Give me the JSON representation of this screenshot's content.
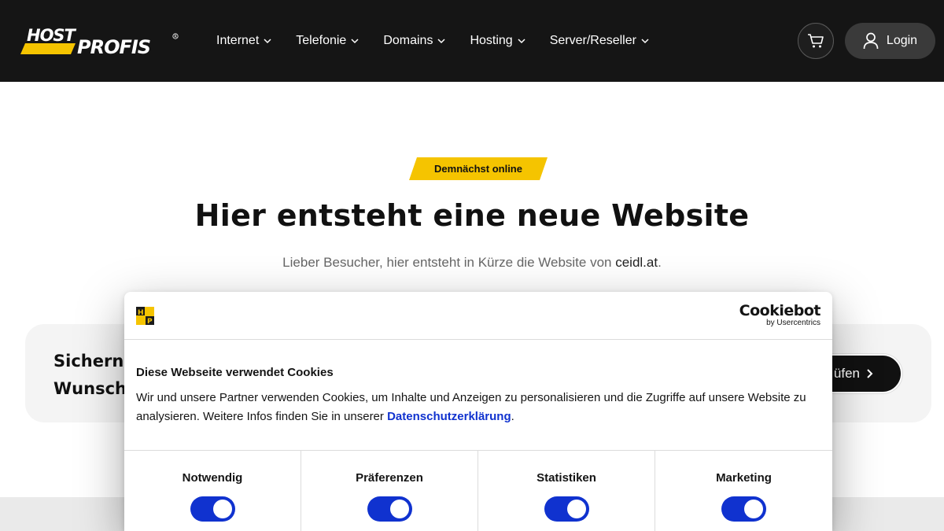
{
  "header": {
    "logo_text": "HOST PROFIS",
    "nav": [
      {
        "label": "Internet"
      },
      {
        "label": "Telefonie"
      },
      {
        "label": "Domains"
      },
      {
        "label": "Hosting"
      },
      {
        "label": "Server/Reseller"
      }
    ],
    "cart_icon": "shopping-cart-icon",
    "login_label": "Login",
    "login_icon": "user-icon"
  },
  "hero": {
    "badge": "Demnächst online",
    "title": "Hier entsteht eine neue Website",
    "subtitle_prefix": "Lieber Besucher, hier entsteht in Kürze die Website von ",
    "subtitle_domain": "ceidl.at",
    "subtitle_suffix": "."
  },
  "domain_section": {
    "line1": "Sichern",
    "line2": "Wunsch",
    "check_button_label": "üfen"
  },
  "cookie_dialog": {
    "brand": "Cookiebot",
    "brand_sub": "by Usercentrics",
    "title": "Diese Webseite verwendet Cookies",
    "body_text": "Wir und unsere Partner verwenden Cookies, um Inhalte und Anzeigen zu personalisieren und die Zugriffe auf unsere Website zu analysieren. Weitere Infos finden Sie in unserer ",
    "privacy_link": "Datenschutzerklärung",
    "body_end": ".",
    "categories": [
      {
        "label": "Notwendig",
        "enabled": true
      },
      {
        "label": "Präferenzen",
        "enabled": true
      },
      {
        "label": "Statistiken",
        "enabled": true
      },
      {
        "label": "Marketing",
        "enabled": true
      }
    ]
  },
  "colors": {
    "header_bg": "#151515",
    "accent_yellow": "#f5c400",
    "toggle_blue": "#1032cf"
  }
}
